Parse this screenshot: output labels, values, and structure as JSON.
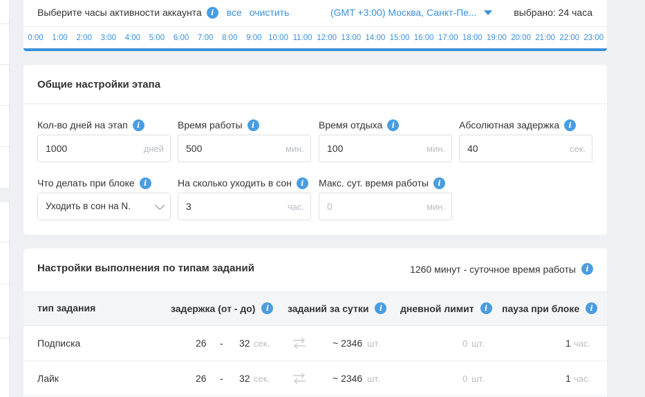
{
  "hours": {
    "title": "Выберите часы активности аккаунта",
    "all_label": "все",
    "clear_label": "очистить",
    "timezone": "(GMT +3:00) Москва, Санкт-Пе...",
    "selected_text": "выбрано: 24 часа",
    "list": [
      "0:00",
      "1:00",
      "2:00",
      "3:00",
      "4:00",
      "5:00",
      "6:00",
      "7:00",
      "8:00",
      "9:00",
      "10:00",
      "11:00",
      "12:00",
      "13:00",
      "14:00",
      "15:00",
      "16:00",
      "17:00",
      "18:00",
      "19:00",
      "20:00",
      "21:00",
      "22:00",
      "23:00"
    ],
    "accent": "#3a8fd9"
  },
  "settings": {
    "title": "Общие настройки этапа",
    "fields": {
      "days": {
        "label": "Кол-во дней на этап",
        "value": "1000",
        "unit": "дней"
      },
      "work": {
        "label": "Время работы",
        "value": "500",
        "unit": "мин."
      },
      "rest": {
        "label": "Время отдыха",
        "value": "100",
        "unit": "мин."
      },
      "delay": {
        "label": "Абсолютная задержка",
        "value": "40",
        "unit": "сек."
      },
      "on_block": {
        "label": "Что делать при блоке",
        "value": "Уходить в сон на N."
      },
      "sleep": {
        "label": "На сколько уходить в сон",
        "value": "3",
        "unit": "час."
      },
      "max_daily": {
        "label": "Макс. сут. время работы",
        "placeholder": "0",
        "unit": "мин."
      }
    }
  },
  "tasks": {
    "title": "Настройки выполнения по типам заданий",
    "daily_time": "1260 минут - суточное время работы",
    "columns": {
      "type": "тип задания",
      "delay": "задержка (от - до)",
      "per_day": "заданий за сутки",
      "limit": "дневной лимит",
      "pause": "пауза при блоке"
    },
    "rows": [
      {
        "type": "Подписка",
        "from": "26",
        "dash": "-",
        "to": "32",
        "delay_unit": "сек.",
        "per_day": "~ 2346",
        "per_day_unit": "шт.",
        "limit": "0",
        "limit_unit": "шт.",
        "pause": "1",
        "pause_unit": "час."
      },
      {
        "type": "Лайк",
        "from": "26",
        "dash": "-",
        "to": "32",
        "delay_unit": "сек.",
        "per_day": "~ 2346",
        "per_day_unit": "шт.",
        "limit": "0",
        "limit_unit": "шт.",
        "pause": "1",
        "pause_unit": "час."
      }
    ]
  },
  "icons": {
    "info": "info-icon",
    "swap": "swap-arrows-icon",
    "dropdown": "chevron-down-icon",
    "timezone_caret": "caret-down-icon"
  }
}
